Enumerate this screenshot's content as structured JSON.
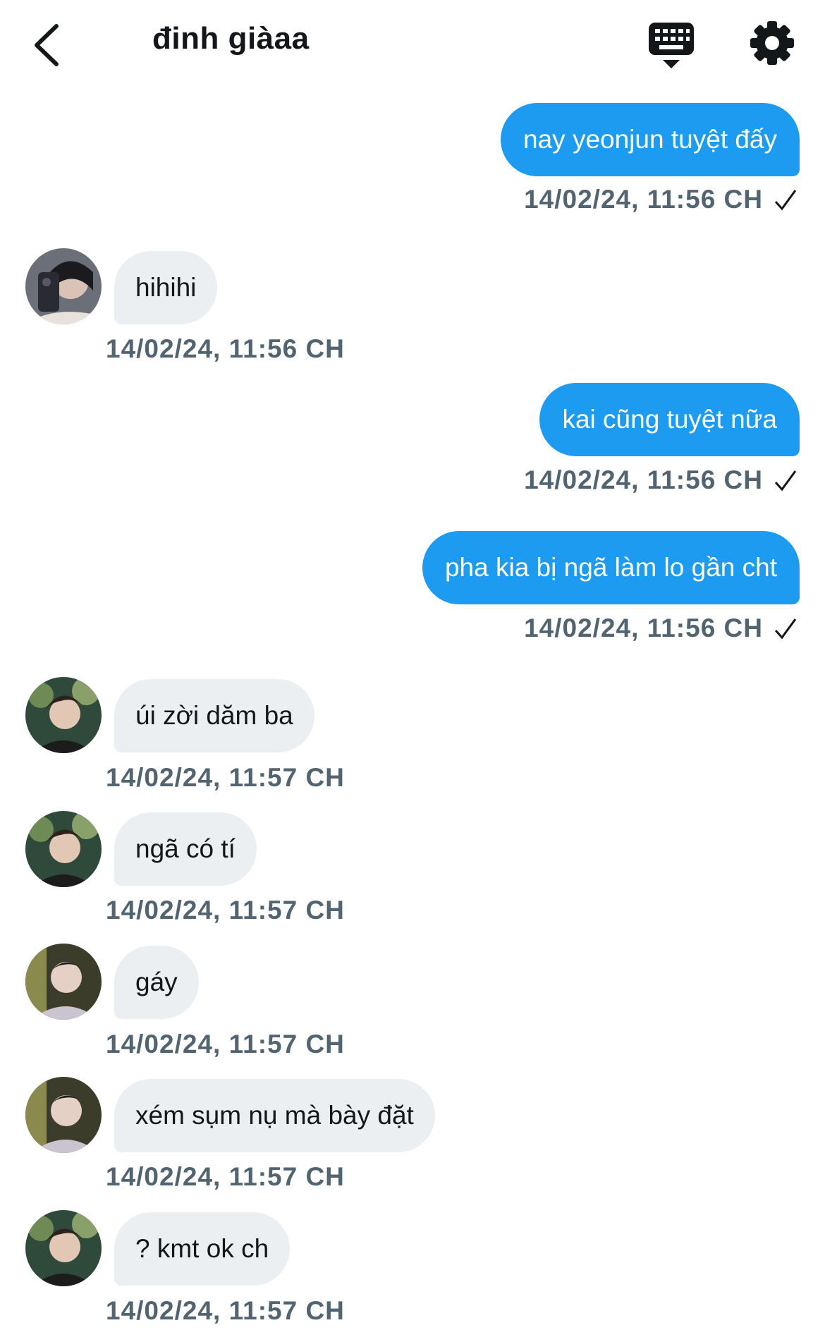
{
  "header": {
    "title": "đinh giàaa",
    "back_icon": "chevron-left-icon",
    "keyboard_icon": "keyboard-icon",
    "settings_icon": "gear-icon"
  },
  "colors": {
    "outgoing_bubble": "#1d9bf0",
    "incoming_bubble": "#eceff2",
    "timestamp": "#536471",
    "text_dark": "#14171a"
  },
  "messages": [
    {
      "direction": "out",
      "text": "nay yeonjun tuyệt đấy",
      "time": "14/02/24, 11:56 CH",
      "read": true
    },
    {
      "direction": "in",
      "text": "hihihi",
      "time": "14/02/24, 11:56 CH"
    },
    {
      "direction": "out",
      "text": "kai cũng tuyệt nữa",
      "time": "14/02/24, 11:56 CH",
      "read": true
    },
    {
      "direction": "out",
      "text": "pha kia bị ngã làm lo gần cht",
      "time": "14/02/24, 11:56 CH",
      "read": true
    },
    {
      "direction": "in",
      "text": "úi zời dăm ba",
      "time": "14/02/24, 11:57 CH"
    },
    {
      "direction": "in",
      "text": "ngã có tí",
      "time": "14/02/24, 11:57 CH"
    },
    {
      "direction": "in",
      "text": "gáy",
      "time": "14/02/24, 11:57 CH"
    },
    {
      "direction": "in",
      "text": "xém sụm nụ mà bày đặt",
      "time": "14/02/24, 11:57 CH"
    },
    {
      "direction": "in",
      "text": "? kmt ok ch",
      "time": "14/02/24, 11:57 CH"
    }
  ]
}
